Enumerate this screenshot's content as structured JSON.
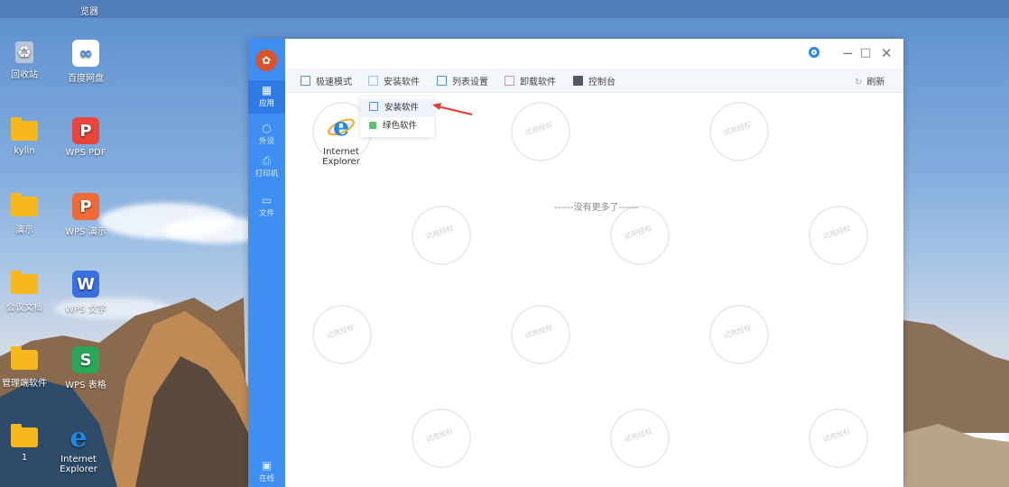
{
  "desktop": {
    "icons": [
      {
        "label": "览器"
      },
      {
        "label": "回收站"
      },
      {
        "label": "百度网盘"
      },
      {
        "label": "kylin"
      },
      {
        "label": "WPS PDF"
      },
      {
        "label": "演示"
      },
      {
        "label": "WPS 演示"
      },
      {
        "label": "会议文档"
      },
      {
        "label": "WPS 文字"
      },
      {
        "label": "管理端软件"
      },
      {
        "label": "WPS 表格"
      },
      {
        "label": "1"
      },
      {
        "label": "Internet Explorer"
      }
    ]
  },
  "app": {
    "sidebar": [
      {
        "label": "应用",
        "icon": "apps-grid-icon"
      },
      {
        "label": "外设",
        "icon": "peripheral-icon"
      },
      {
        "label": "打印机",
        "icon": "printer-icon"
      },
      {
        "label": "文件",
        "icon": "folder-icon"
      },
      {
        "label": "在线",
        "icon": "online-monitor-icon"
      }
    ],
    "toolbar": {
      "speed_mode": "极速模式",
      "install_software": "安装软件",
      "list_settings": "列表设置",
      "uninstall_software": "卸载软件",
      "console": "控制台",
      "refresh": "刷新"
    },
    "dropdown": {
      "install": "安装软件",
      "green": "绿色软件"
    },
    "content": {
      "apps": [
        {
          "label": "Internet Explorer"
        }
      ],
      "no_more": "------没有更多了------",
      "watermark": "试用授权"
    },
    "colors": {
      "sidebar": "#3f8ff2",
      "accent": "#2e86ef",
      "arrow": "#e53b33"
    }
  }
}
